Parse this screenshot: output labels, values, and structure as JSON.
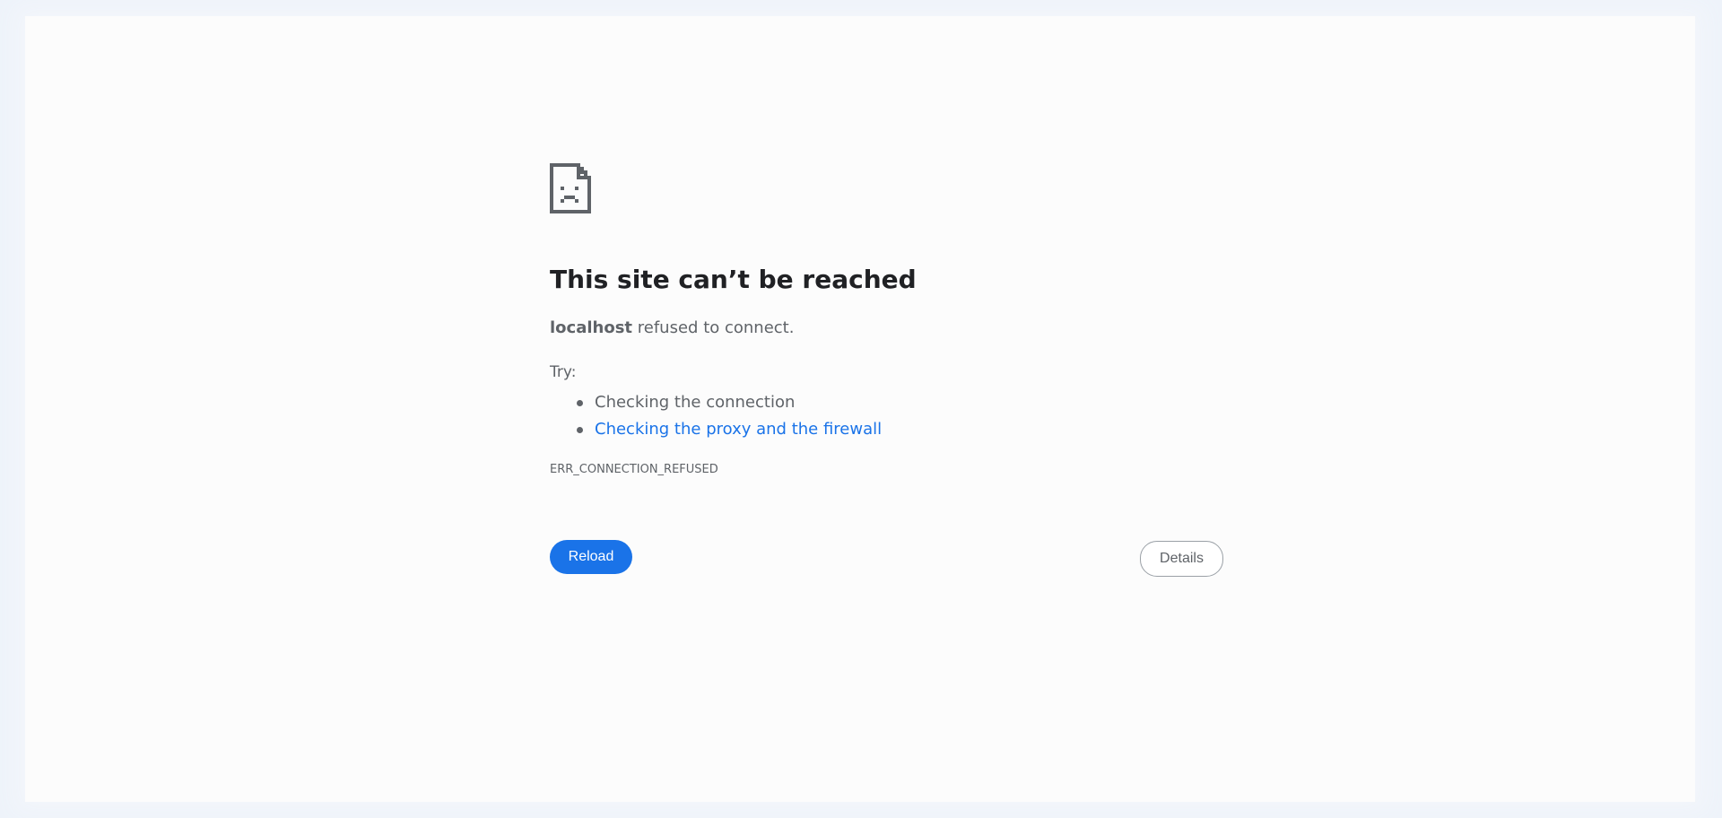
{
  "error_page": {
    "title": "This site can’t be reached",
    "host": "localhost",
    "summary_rest": "refused to connect.",
    "try_label": "Try:",
    "suggestions": [
      {
        "text": "Checking the connection",
        "link": false
      },
      {
        "text": "Checking the proxy and the firewall",
        "link": true
      }
    ],
    "error_code": "ERR_CONNECTION_REFUSED"
  },
  "buttons": {
    "reload_label": "Reload",
    "details_label": "Details"
  },
  "icons": {
    "main": "sad-page-icon"
  },
  "colors": {
    "accent": "#1a73e8",
    "text": "#5f6368",
    "title": "#202124",
    "background": "#fcfcfc"
  }
}
